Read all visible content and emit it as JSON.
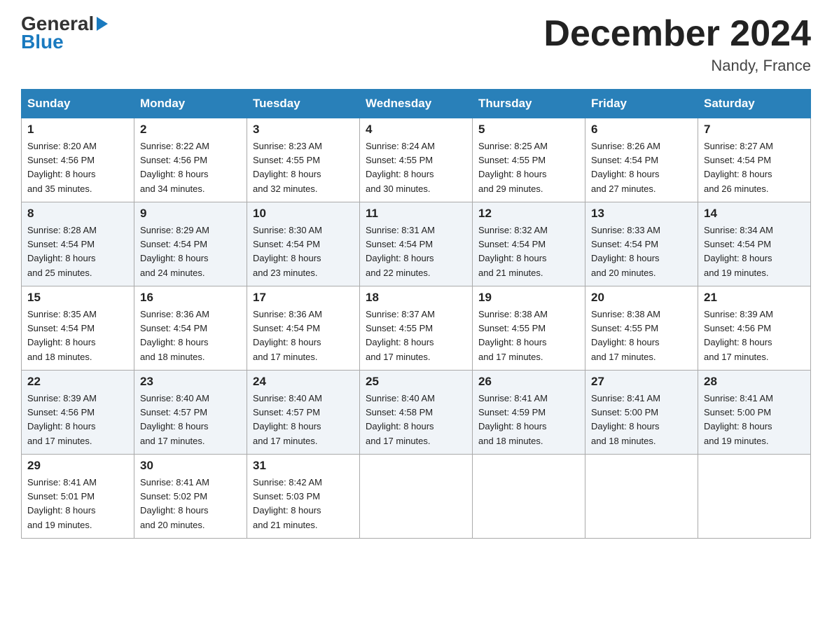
{
  "header": {
    "logo_general": "General",
    "logo_blue": "Blue",
    "month_title": "December 2024",
    "location": "Nandy, France"
  },
  "days_of_week": [
    "Sunday",
    "Monday",
    "Tuesday",
    "Wednesday",
    "Thursday",
    "Friday",
    "Saturday"
  ],
  "weeks": [
    [
      {
        "day": "1",
        "sunrise": "8:20 AM",
        "sunset": "4:56 PM",
        "daylight": "8 hours and 35 minutes."
      },
      {
        "day": "2",
        "sunrise": "8:22 AM",
        "sunset": "4:56 PM",
        "daylight": "8 hours and 34 minutes."
      },
      {
        "day": "3",
        "sunrise": "8:23 AM",
        "sunset": "4:55 PM",
        "daylight": "8 hours and 32 minutes."
      },
      {
        "day": "4",
        "sunrise": "8:24 AM",
        "sunset": "4:55 PM",
        "daylight": "8 hours and 30 minutes."
      },
      {
        "day": "5",
        "sunrise": "8:25 AM",
        "sunset": "4:55 PM",
        "daylight": "8 hours and 29 minutes."
      },
      {
        "day": "6",
        "sunrise": "8:26 AM",
        "sunset": "4:54 PM",
        "daylight": "8 hours and 27 minutes."
      },
      {
        "day": "7",
        "sunrise": "8:27 AM",
        "sunset": "4:54 PM",
        "daylight": "8 hours and 26 minutes."
      }
    ],
    [
      {
        "day": "8",
        "sunrise": "8:28 AM",
        "sunset": "4:54 PM",
        "daylight": "8 hours and 25 minutes."
      },
      {
        "day": "9",
        "sunrise": "8:29 AM",
        "sunset": "4:54 PM",
        "daylight": "8 hours and 24 minutes."
      },
      {
        "day": "10",
        "sunrise": "8:30 AM",
        "sunset": "4:54 PM",
        "daylight": "8 hours and 23 minutes."
      },
      {
        "day": "11",
        "sunrise": "8:31 AM",
        "sunset": "4:54 PM",
        "daylight": "8 hours and 22 minutes."
      },
      {
        "day": "12",
        "sunrise": "8:32 AM",
        "sunset": "4:54 PM",
        "daylight": "8 hours and 21 minutes."
      },
      {
        "day": "13",
        "sunrise": "8:33 AM",
        "sunset": "4:54 PM",
        "daylight": "8 hours and 20 minutes."
      },
      {
        "day": "14",
        "sunrise": "8:34 AM",
        "sunset": "4:54 PM",
        "daylight": "8 hours and 19 minutes."
      }
    ],
    [
      {
        "day": "15",
        "sunrise": "8:35 AM",
        "sunset": "4:54 PM",
        "daylight": "8 hours and 18 minutes."
      },
      {
        "day": "16",
        "sunrise": "8:36 AM",
        "sunset": "4:54 PM",
        "daylight": "8 hours and 18 minutes."
      },
      {
        "day": "17",
        "sunrise": "8:36 AM",
        "sunset": "4:54 PM",
        "daylight": "8 hours and 17 minutes."
      },
      {
        "day": "18",
        "sunrise": "8:37 AM",
        "sunset": "4:55 PM",
        "daylight": "8 hours and 17 minutes."
      },
      {
        "day": "19",
        "sunrise": "8:38 AM",
        "sunset": "4:55 PM",
        "daylight": "8 hours and 17 minutes."
      },
      {
        "day": "20",
        "sunrise": "8:38 AM",
        "sunset": "4:55 PM",
        "daylight": "8 hours and 17 minutes."
      },
      {
        "day": "21",
        "sunrise": "8:39 AM",
        "sunset": "4:56 PM",
        "daylight": "8 hours and 17 minutes."
      }
    ],
    [
      {
        "day": "22",
        "sunrise": "8:39 AM",
        "sunset": "4:56 PM",
        "daylight": "8 hours and 17 minutes."
      },
      {
        "day": "23",
        "sunrise": "8:40 AM",
        "sunset": "4:57 PM",
        "daylight": "8 hours and 17 minutes."
      },
      {
        "day": "24",
        "sunrise": "8:40 AM",
        "sunset": "4:57 PM",
        "daylight": "8 hours and 17 minutes."
      },
      {
        "day": "25",
        "sunrise": "8:40 AM",
        "sunset": "4:58 PM",
        "daylight": "8 hours and 17 minutes."
      },
      {
        "day": "26",
        "sunrise": "8:41 AM",
        "sunset": "4:59 PM",
        "daylight": "8 hours and 18 minutes."
      },
      {
        "day": "27",
        "sunrise": "8:41 AM",
        "sunset": "5:00 PM",
        "daylight": "8 hours and 18 minutes."
      },
      {
        "day": "28",
        "sunrise": "8:41 AM",
        "sunset": "5:00 PM",
        "daylight": "8 hours and 19 minutes."
      }
    ],
    [
      {
        "day": "29",
        "sunrise": "8:41 AM",
        "sunset": "5:01 PM",
        "daylight": "8 hours and 19 minutes."
      },
      {
        "day": "30",
        "sunrise": "8:41 AM",
        "sunset": "5:02 PM",
        "daylight": "8 hours and 20 minutes."
      },
      {
        "day": "31",
        "sunrise": "8:42 AM",
        "sunset": "5:03 PM",
        "daylight": "8 hours and 21 minutes."
      },
      null,
      null,
      null,
      null
    ]
  ],
  "labels": {
    "sunrise": "Sunrise:",
    "sunset": "Sunset:",
    "daylight": "Daylight:"
  }
}
